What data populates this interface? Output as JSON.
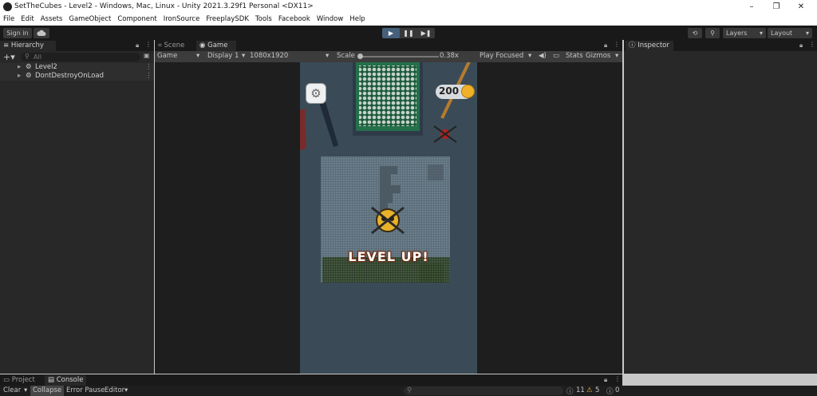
{
  "window": {
    "title": "SetTheCubes - Level2 - Windows, Mac, Linux - Unity 2021.3.29f1 Personal <DX11>",
    "controls": [
      "–",
      "❐",
      "✕"
    ]
  },
  "menu": [
    "File",
    "Edit",
    "Assets",
    "GameObject",
    "Component",
    "IronSource",
    "FreeplaySDK",
    "Tools",
    "Facebook",
    "Window",
    "Help"
  ],
  "toolbar": {
    "sign_in": "Sign in",
    "play": "▶",
    "pause": "❚❚",
    "step": "▶❚",
    "layers": "Layers",
    "layout": "Layout"
  },
  "hierarchy": {
    "tab": "Hierarchy",
    "search_placeholder": "All",
    "items": [
      "Level2",
      "DontDestroyOnLoad"
    ]
  },
  "center_tabs": {
    "scene": "Scene",
    "game": "Game"
  },
  "game_toolbar": {
    "mode": "Game",
    "display": "Display 1",
    "resolution": "1080x1920",
    "scale_label": "Scale",
    "scale_value": "0.38x",
    "play_focused": "Play Focused",
    "stats": "Stats",
    "gizmos": "Gizmos"
  },
  "game": {
    "coins": "200",
    "level_up": "LEVEL UP!"
  },
  "inspector": {
    "tab": "Inspector"
  },
  "bottom": {
    "project_tab": "Project",
    "console_tab": "Console",
    "clear": "Clear",
    "collapse": "Collapse",
    "error_pause": "Error Pause",
    "editor": "Editor",
    "log_count": "11",
    "warn_count": "5",
    "error_count": "0"
  },
  "colors": {
    "accent_play": "#46607c",
    "panel": "#282828",
    "toolbar": "#191919",
    "game_bg": "#3a4b57",
    "coin": "#f0b12a",
    "level_up_text": "#ffffff"
  }
}
